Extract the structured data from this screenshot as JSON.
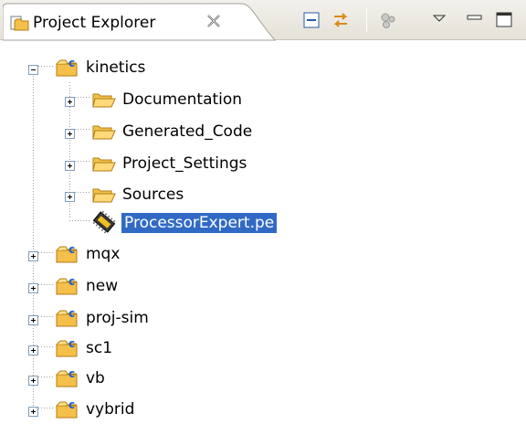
{
  "view": {
    "title": "Project Explorer",
    "icons": {
      "view": "project-explorer-icon",
      "close": "close-icon",
      "collapse_all": "collapse-all-icon",
      "link_with_editor": "link-with-editor-icon",
      "gears": "gears-icon",
      "view_menu": "view-menu-icon",
      "minimize": "minimize-icon",
      "maximize": "maximize-icon"
    }
  },
  "tree": {
    "projects": [
      {
        "name": "kinetics",
        "expanded": true,
        "children": [
          {
            "name": "Documentation",
            "type": "folder"
          },
          {
            "name": "Generated_Code",
            "type": "folder"
          },
          {
            "name": "Project_Settings",
            "type": "folder"
          },
          {
            "name": "Sources",
            "type": "folder"
          },
          {
            "name": "ProcessorExpert.pe",
            "type": "file",
            "selected": true
          }
        ]
      },
      {
        "name": "mqx",
        "expanded": false
      },
      {
        "name": "new",
        "expanded": false
      },
      {
        "name": "proj-sim",
        "expanded": false
      },
      {
        "name": "sc1",
        "expanded": false
      },
      {
        "name": "vb",
        "expanded": false
      },
      {
        "name": "vybrid",
        "expanded": false
      }
    ]
  },
  "colors": {
    "selection": "#316ac5",
    "folder": "#f5c04a",
    "project_c": "#1e5fd0"
  }
}
